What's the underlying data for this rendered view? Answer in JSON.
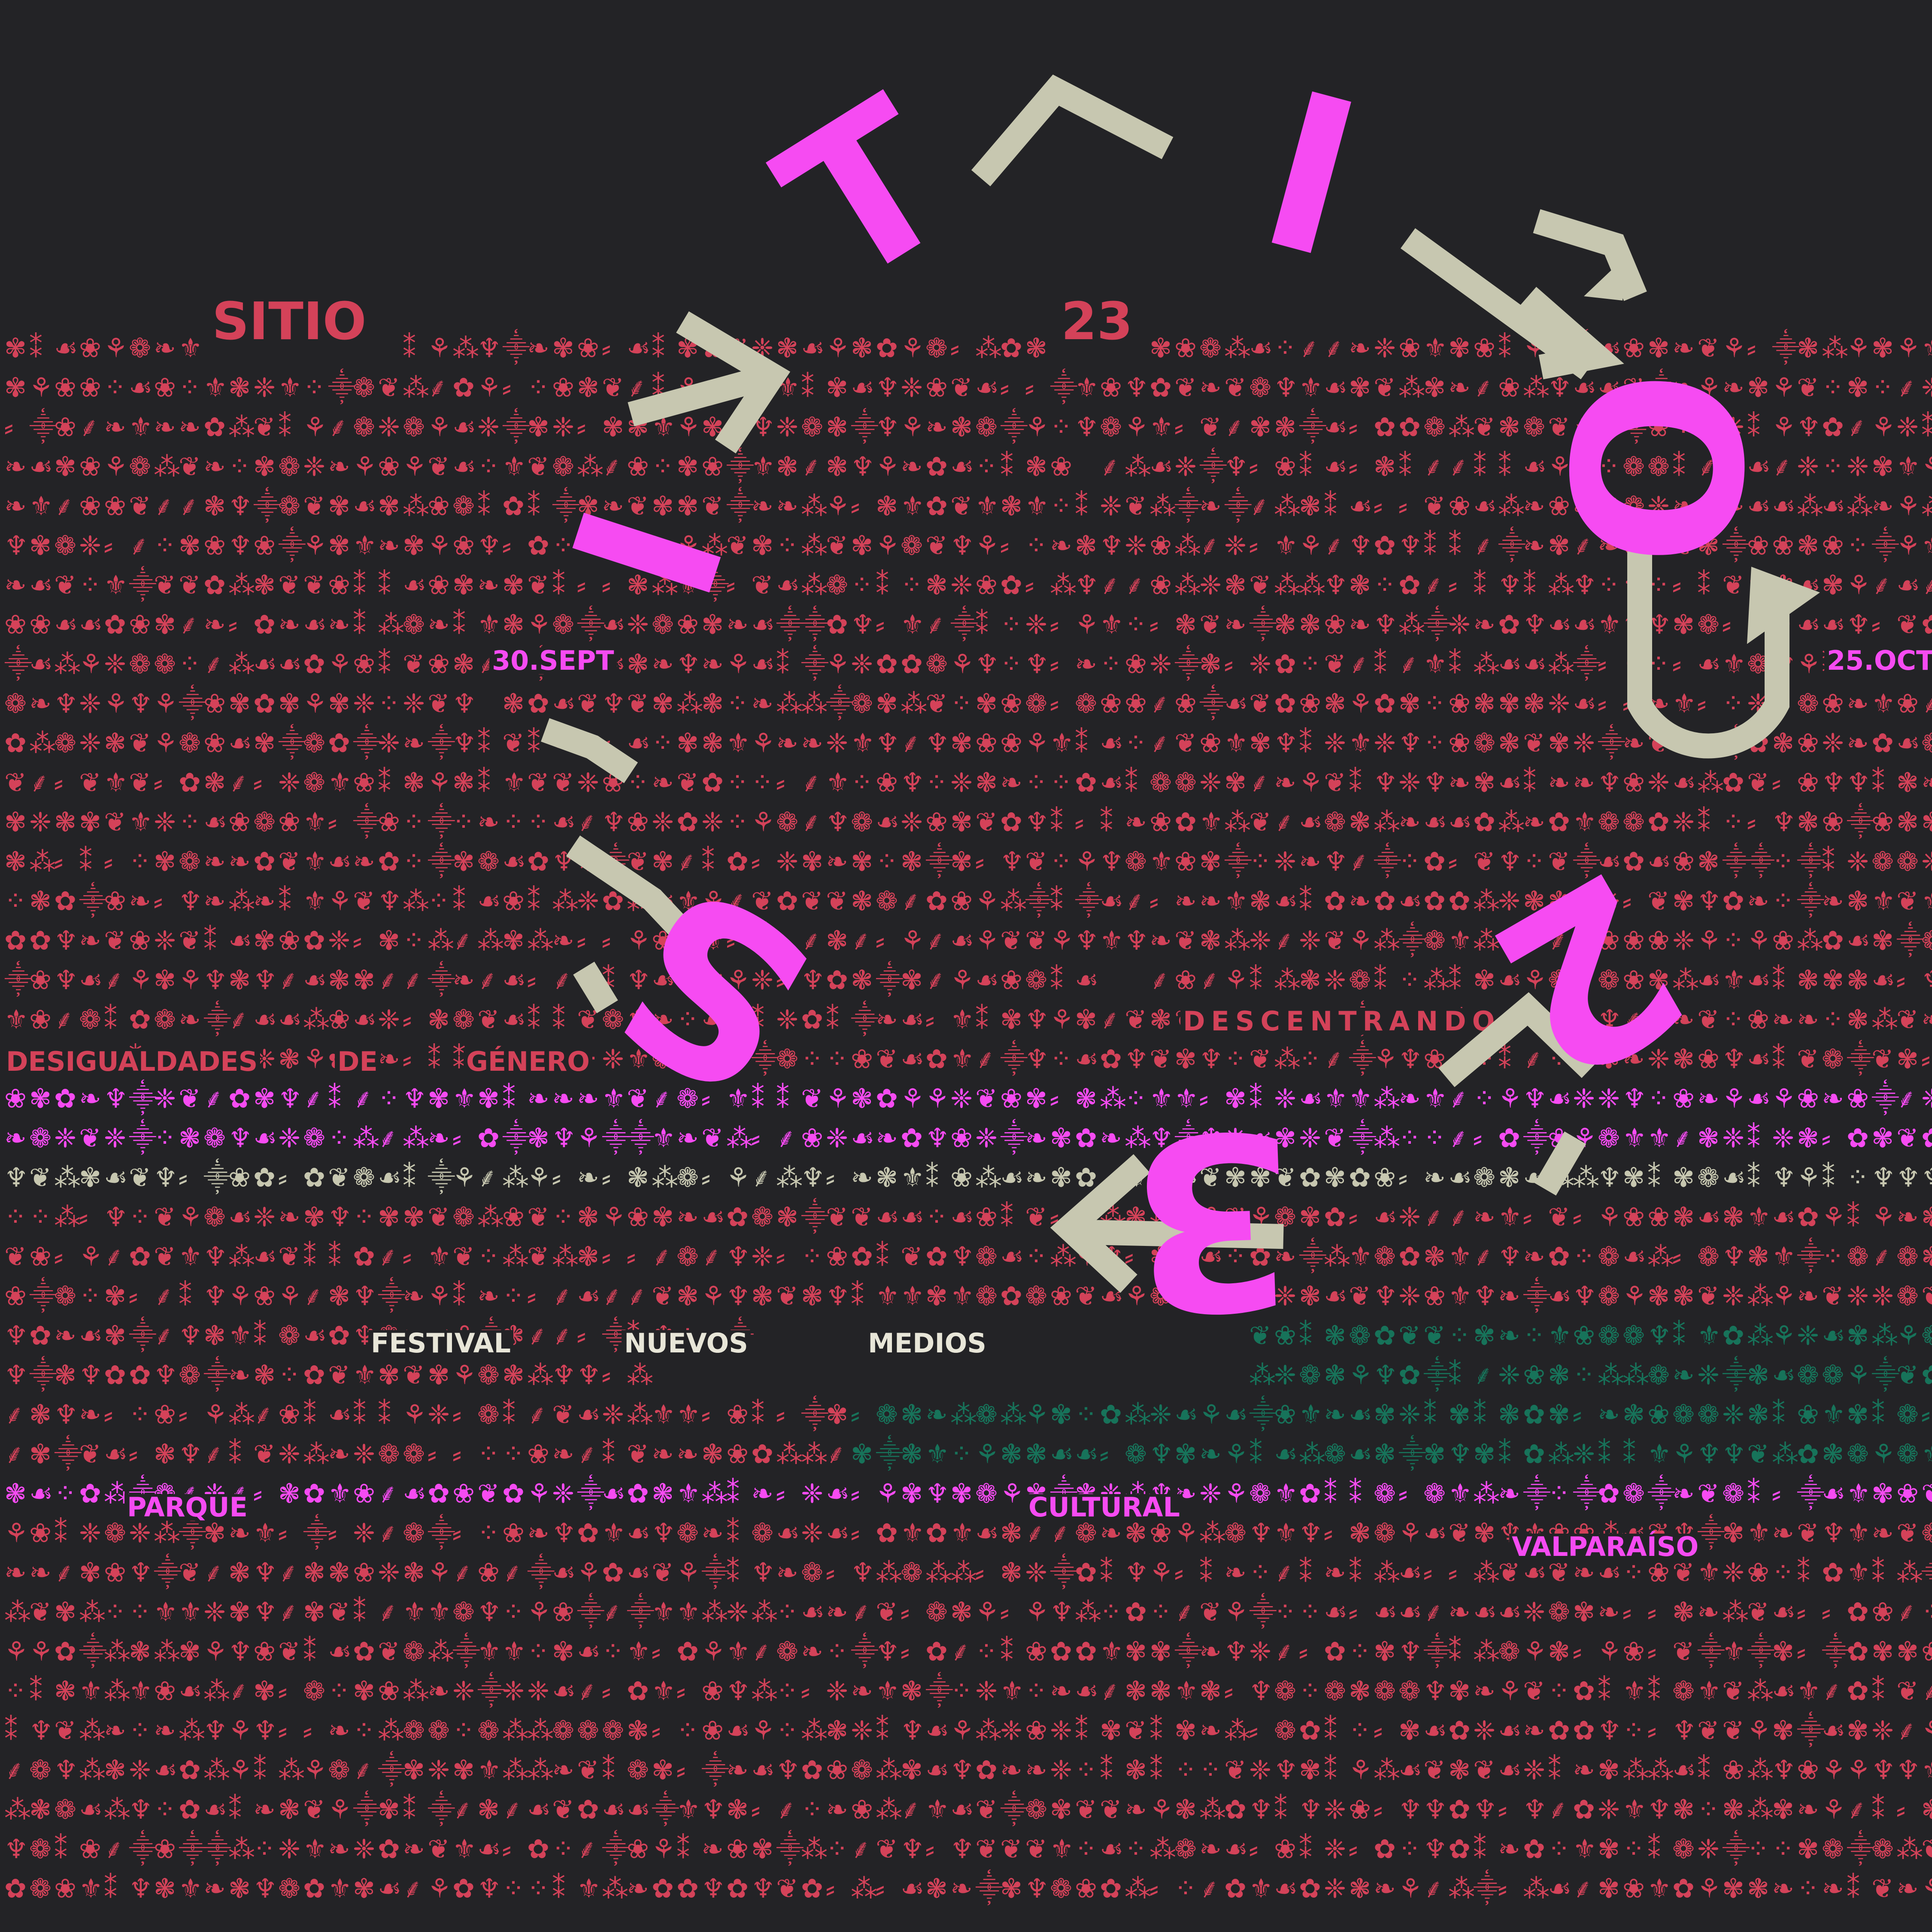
{
  "colors": {
    "background": "#232326",
    "red": "#d44259",
    "magenta": "#f64bf2",
    "cream": "#c7c7b0",
    "green": "#17735a"
  },
  "header": {
    "brand": "SITIO",
    "edition": "23",
    "start_date": "30.SEPT",
    "end_date": "25.OCT"
  },
  "theme": {
    "lead": "DESCENTRANDO",
    "word1": "DESIGUALDADES",
    "word2": "DE",
    "word3": "GÉNERO"
  },
  "festival": {
    "word1": "FESTIVAL",
    "word2": "NUEVOS",
    "word3": "MEDIOS"
  },
  "venue": {
    "word1": "PARQUE",
    "word2": "CULTURAL",
    "city": "VALPARAÍSO"
  },
  "circle_letters": {
    "s": "S",
    "i1": "I",
    "t": "T",
    "i2": "I",
    "o": "O",
    "two": "2",
    "three": "3"
  },
  "ornament_glyphs": [
    "❦",
    "❧",
    "☙",
    "✿",
    "❀",
    "⁂",
    "⸙",
    "⚘",
    "✾",
    "❁",
    "⁑",
    "⸎",
    "⸗",
    "⁘",
    "♆",
    "⚜",
    "❈",
    "❃"
  ],
  "icons": [
    "ornament-pattern",
    "arrow-icon",
    "caret-icon",
    "spiral-arrow-icon"
  ]
}
